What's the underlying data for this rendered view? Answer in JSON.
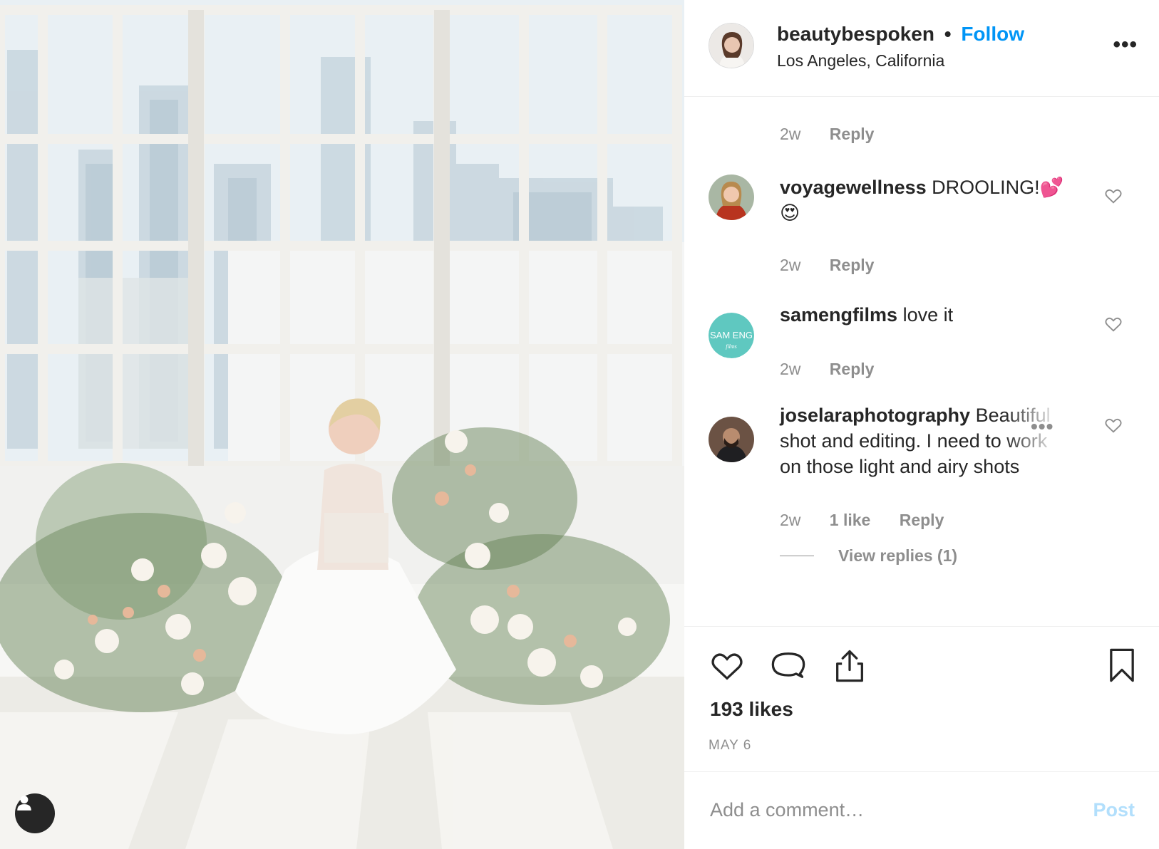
{
  "post": {
    "owner": "beautybespoken",
    "separator": "•",
    "follow_label": "Follow",
    "location": "Los Angeles, California",
    "more_label": "•••"
  },
  "comments": [
    {
      "username": "voyagewellness",
      "text": "DROOLING!💕 😍",
      "time": "2w",
      "reply_label": "Reply"
    },
    {
      "username": "samengfilms",
      "text": "love it",
      "time": "2w",
      "reply_label": "Reply"
    },
    {
      "username": "joselaraphotography",
      "text": "Beautiful shot and editing. I need to work on those light and airy shots",
      "time": "2w",
      "likes_label": "1 like",
      "reply_label": "Reply",
      "view_replies_label": "View replies (1)"
    }
  ],
  "previous_comment": {
    "time": "2w",
    "reply_label": "Reply"
  },
  "likes_label": "193 likes",
  "date_label": "MAY 6",
  "composer": {
    "placeholder": "Add a comment…",
    "post_label": "Post"
  },
  "avatar_badge_text": "SAM ENG",
  "avatar_badge_sub": "films",
  "comment_more_label": "•••",
  "colors": {
    "accent": "#0095f6",
    "muted": "#8e8e8e",
    "post_disabled": "#b2dffc",
    "text": "#262626",
    "sameng_teal": "#5fc8c0"
  },
  "icons": {
    "like": "heart-icon",
    "comment": "comment-bubble-icon",
    "share": "share-icon",
    "save": "bookmark-icon",
    "user_tag": "person-icon"
  }
}
